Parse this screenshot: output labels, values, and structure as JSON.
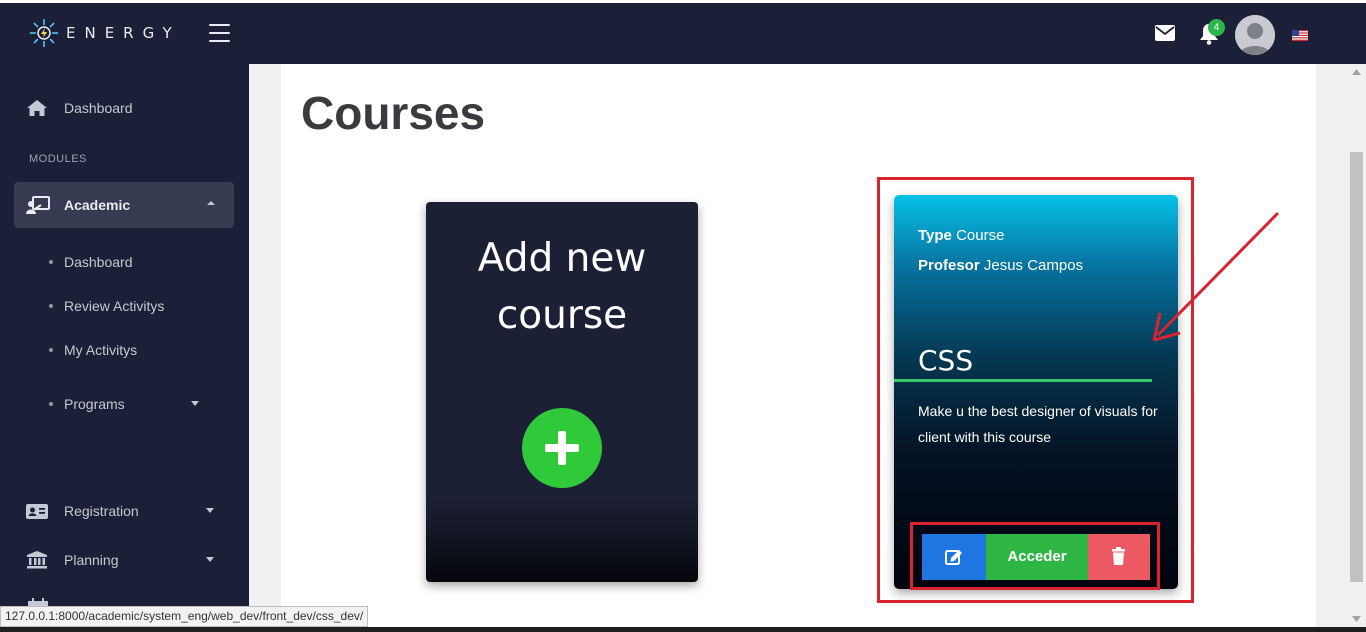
{
  "brand": {
    "name": "ENERGY",
    "logo_icon": "energy-logo-icon"
  },
  "header": {
    "menu_icon": "hamburger-icon",
    "mail_icon": "envelope-icon",
    "bell_icon": "bell-icon",
    "notification_count": "4",
    "avatar_icon": "user-avatar",
    "flag_icon": "us-flag-icon"
  },
  "sidebar": {
    "dashboard_label": "Dashboard",
    "modules_heading": "MODULES",
    "academic_label": "Academic",
    "academic_sub": [
      {
        "label": "Dashboard"
      },
      {
        "label": "Review Activitys"
      },
      {
        "label": "My Activitys"
      },
      {
        "label": "Programs"
      }
    ],
    "registration_label": "Registration",
    "planning_label": "Planning"
  },
  "main": {
    "title": "Courses",
    "add_card": {
      "title_line1": "Add new",
      "title_line2": "course"
    },
    "course_card": {
      "type_label": "Type",
      "type_value": "Course",
      "professor_label": "Profesor",
      "professor_value": "Jesus Campos",
      "name": "CSS",
      "description": "Make u the best designer of visuals for client with this course",
      "access_label": "Acceder"
    }
  },
  "status_bar": {
    "url": "127.0.0.1:8000/academic/system_eng/web_dev/front_dev/css_dev/"
  },
  "colors": {
    "header_bg": "#1b2038",
    "sidebar_bg": "#1b2038",
    "accent_green": "#2fc93a",
    "edit_blue": "#1f76e1",
    "delete_red": "#ee5a64",
    "highlight_red": "#d9242f"
  }
}
